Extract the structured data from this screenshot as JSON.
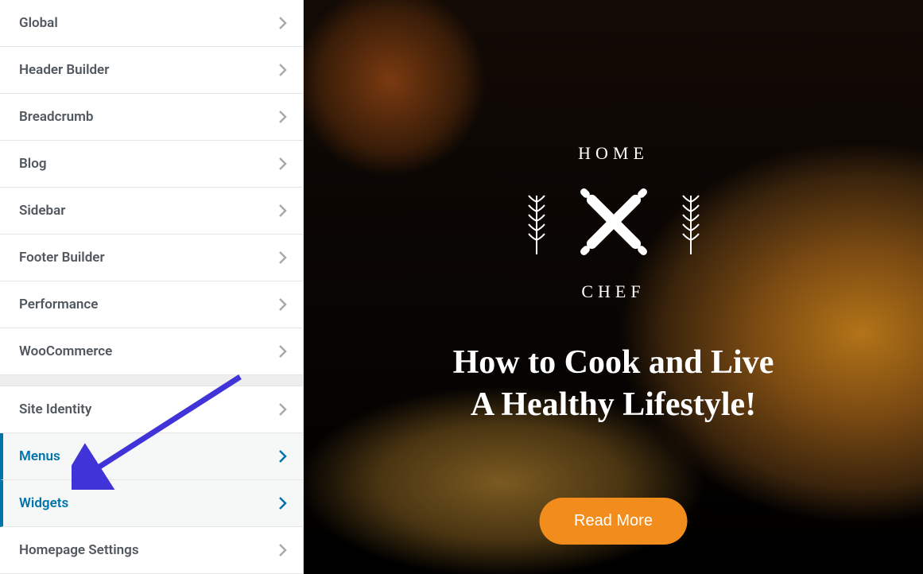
{
  "sidebar": {
    "groups": [
      {
        "items": [
          {
            "label": "Global",
            "active": false
          },
          {
            "label": "Header Builder",
            "active": false
          },
          {
            "label": "Breadcrumb",
            "active": false
          },
          {
            "label": "Blog",
            "active": false
          },
          {
            "label": "Sidebar",
            "active": false
          },
          {
            "label": "Footer Builder",
            "active": false
          },
          {
            "label": "Performance",
            "active": false
          },
          {
            "label": "WooCommerce",
            "active": false
          }
        ]
      },
      {
        "items": [
          {
            "label": "Site Identity",
            "active": false
          },
          {
            "label": "Menus",
            "active": true
          },
          {
            "label": "Widgets",
            "active": true
          },
          {
            "label": "Homepage Settings",
            "active": false
          }
        ]
      }
    ]
  },
  "preview": {
    "logo_top": "HOME",
    "logo_bottom": "CHEF",
    "hero_line1": "How to Cook and Live",
    "hero_line2": "A Healthy Lifestyle!",
    "cta_label": "Read More"
  },
  "annotation": {
    "type": "arrow",
    "target": "Widgets"
  }
}
